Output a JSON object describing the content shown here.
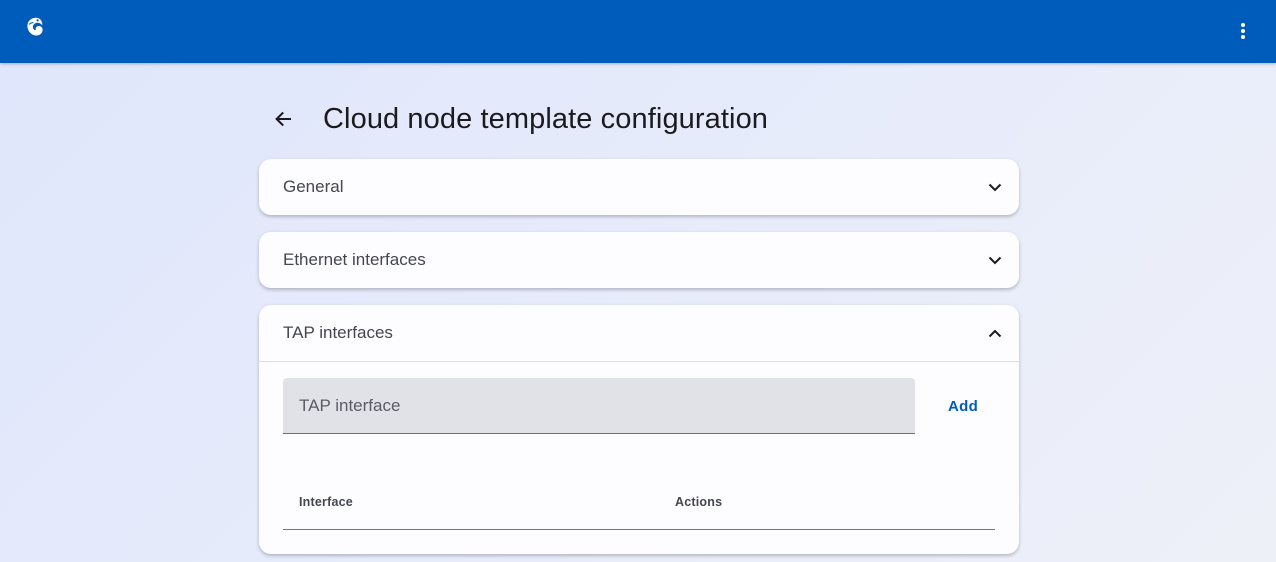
{
  "colors": {
    "brand": "#005cbb",
    "accent": "#005cbb"
  },
  "header": {
    "logo_icon": "gns3-chameleon-logo-icon",
    "menu_icon": "more-vertical-icon"
  },
  "page": {
    "back_icon": "arrow-back-icon",
    "title": "Cloud node template configuration"
  },
  "panels": [
    {
      "title": "General",
      "expanded": false,
      "chevron_icon": "chevron-down-icon"
    },
    {
      "title": "Ethernet interfaces",
      "expanded": false,
      "chevron_icon": "chevron-down-icon"
    },
    {
      "title": "TAP interfaces",
      "expanded": true,
      "chevron_icon": "chevron-up-icon"
    }
  ],
  "tap": {
    "input_placeholder": "TAP interface",
    "input_value": "",
    "add_label": "Add",
    "columns": [
      "Interface",
      "Actions"
    ],
    "rows": []
  }
}
